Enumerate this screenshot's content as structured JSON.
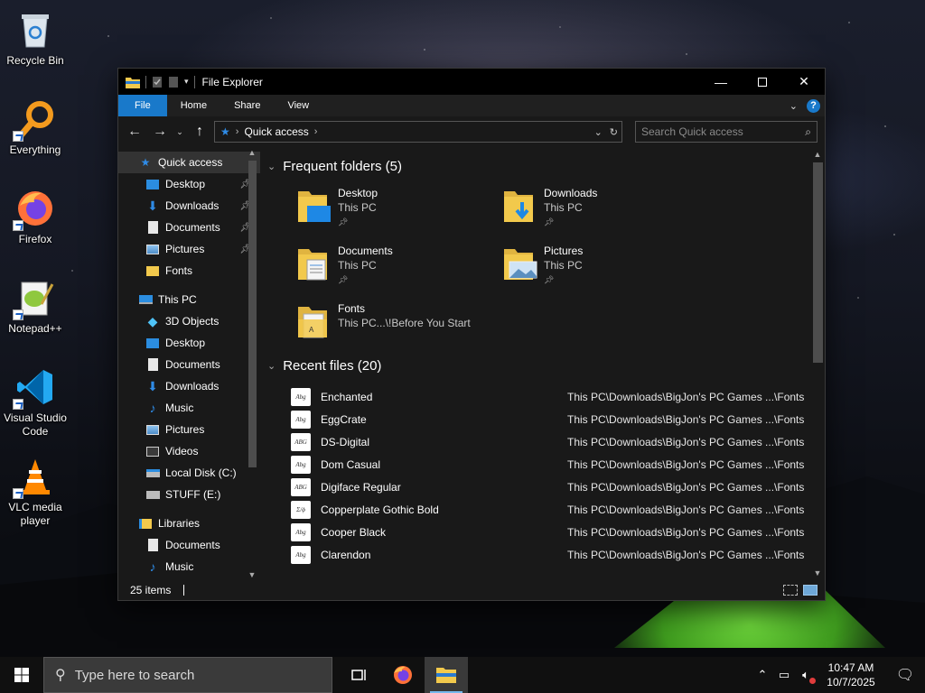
{
  "desktop": {
    "icons": [
      {
        "label": "Recycle Bin"
      },
      {
        "label": "Everything"
      },
      {
        "label": "Firefox"
      },
      {
        "label": "Notepad++"
      },
      {
        "label": "Visual Studio Code"
      },
      {
        "label": "VLC media player"
      }
    ]
  },
  "window": {
    "title": "File Explorer",
    "ribbon_tabs": [
      "File",
      "Home",
      "Share",
      "View"
    ],
    "help_label": "?",
    "address": {
      "location": "Quick access"
    },
    "search": {
      "placeholder": "Search Quick access"
    },
    "sidebar": {
      "quick_access": {
        "label": "Quick access"
      },
      "quick_items": [
        {
          "label": "Desktop",
          "pinned": true
        },
        {
          "label": "Downloads",
          "pinned": true
        },
        {
          "label": "Documents",
          "pinned": true
        },
        {
          "label": "Pictures",
          "pinned": true
        },
        {
          "label": "Fonts",
          "pinned": false
        }
      ],
      "this_pc": {
        "label": "This PC"
      },
      "pc_items": [
        {
          "label": "3D Objects"
        },
        {
          "label": "Desktop"
        },
        {
          "label": "Documents"
        },
        {
          "label": "Downloads"
        },
        {
          "label": "Music"
        },
        {
          "label": "Pictures"
        },
        {
          "label": "Videos"
        },
        {
          "label": "Local Disk (C:)"
        },
        {
          "label": "STUFF (E:)"
        }
      ],
      "libraries": {
        "label": "Libraries"
      },
      "lib_items": [
        {
          "label": "Documents"
        },
        {
          "label": "Music"
        }
      ]
    },
    "frequent": {
      "heading": "Frequent folders (5)",
      "folders": [
        {
          "name": "Desktop",
          "location": "This PC"
        },
        {
          "name": "Downloads",
          "location": "This PC"
        },
        {
          "name": "Documents",
          "location": "This PC"
        },
        {
          "name": "Pictures",
          "location": "This PC"
        },
        {
          "name": "Fonts",
          "location": "This PC...\\!Before You Start"
        }
      ]
    },
    "recent": {
      "heading": "Recent files (20)",
      "files": [
        {
          "name": "Enchanted",
          "path": "This PC\\Downloads\\BigJon's PC Games ...\\Fonts",
          "thumb": "Abg"
        },
        {
          "name": "EggCrate",
          "path": "This PC\\Downloads\\BigJon's PC Games ...\\Fonts",
          "thumb": "Abg"
        },
        {
          "name": "DS-Digital",
          "path": "This PC\\Downloads\\BigJon's PC Games ...\\Fonts",
          "thumb": "ABG"
        },
        {
          "name": "Dom Casual",
          "path": "This PC\\Downloads\\BigJon's PC Games ...\\Fonts",
          "thumb": "Abg"
        },
        {
          "name": "Digiface Regular",
          "path": "This PC\\Downloads\\BigJon's PC Games ...\\Fonts",
          "thumb": "ABG"
        },
        {
          "name": "Copperplate Gothic Bold",
          "path": "This PC\\Downloads\\BigJon's PC Games ...\\Fonts",
          "thumb": "Σ/ϕ"
        },
        {
          "name": "Cooper Black",
          "path": "This PC\\Downloads\\BigJon's PC Games ...\\Fonts",
          "thumb": "Abg"
        },
        {
          "name": "Clarendon",
          "path": "This PC\\Downloads\\BigJon's PC Games ...\\Fonts",
          "thumb": "Abg"
        }
      ]
    },
    "status": {
      "items": "25 items"
    }
  },
  "taskbar": {
    "search_placeholder": "Type here to search",
    "time": "10:47 AM",
    "date": "10/7/2025"
  },
  "colors": {
    "accent": "#1979ca",
    "folder": "#f2c94c",
    "window_bg": "#191919"
  }
}
